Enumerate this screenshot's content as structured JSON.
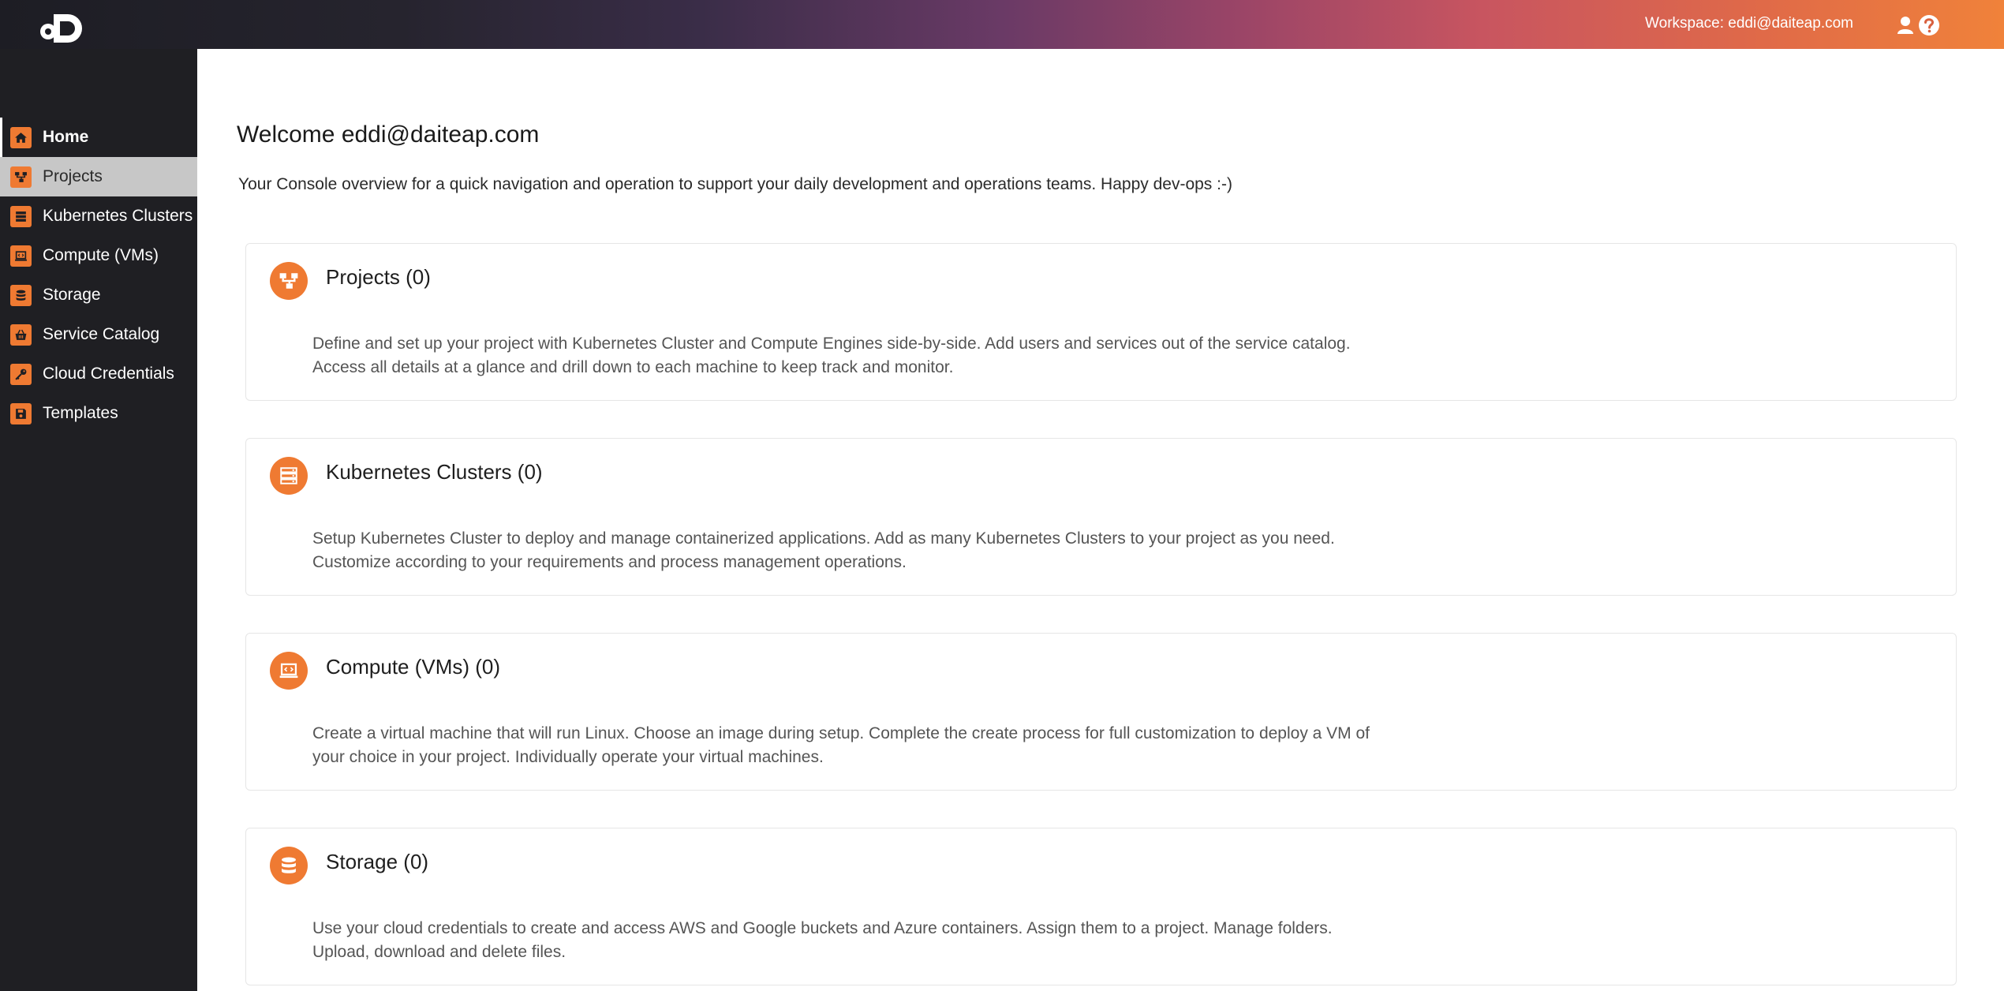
{
  "header": {
    "logo": "daiteap-logo",
    "workspace_label": "Workspace: eddi@daiteap.com",
    "user_icon": "user-icon",
    "help_icon": "help-icon"
  },
  "colors": {
    "accent": "#ef7a32",
    "sidebar_bg": "#1f1f23",
    "hover_bg": "#c7c7c7"
  },
  "sidebar": {
    "items": [
      {
        "label": "Home",
        "icon": "home-icon"
      },
      {
        "label": "Projects",
        "icon": "projects-icon"
      },
      {
        "label": "Kubernetes Clusters",
        "icon": "server-icon"
      },
      {
        "label": "Compute (VMs)",
        "icon": "laptop-icon"
      },
      {
        "label": "Storage",
        "icon": "database-icon"
      },
      {
        "label": "Service Catalog",
        "icon": "basket-icon"
      },
      {
        "label": "Cloud Credentials",
        "icon": "key-icon"
      },
      {
        "label": "Templates",
        "icon": "save-icon"
      }
    ]
  },
  "main": {
    "welcome": "Welcome eddi@daiteap.com",
    "subtitle": "Your Console overview for a quick navigation and operation to support your daily development and operations teams. Happy dev-ops :-)",
    "cards": [
      {
        "title": "Projects (0)",
        "icon": "projects-icon",
        "description": "Define and set up your project with Kubernetes Cluster and Compute Engines side-by-side. Add users and services out of the service catalog. Access all details at a glance and drill down to each machine to keep track and monitor."
      },
      {
        "title": "Kubernetes Clusters (0)",
        "icon": "server-icon",
        "description": "Setup Kubernetes Cluster to deploy and manage containerized applications. Add as many Kubernetes Clusters to your project as you need. Customize according to your requirements and process management operations."
      },
      {
        "title": "Compute (VMs) (0)",
        "icon": "laptop-icon",
        "description": "Create a virtual machine that will run Linux. Choose an image during setup. Complete the create process for full customization to deploy a VM of your choice in your project. Individually operate your virtual machines."
      },
      {
        "title": "Storage (0)",
        "icon": "database-icon",
        "description": "Use your cloud credentials to create and access AWS and Google buckets and Azure containers. Assign them to a project. Manage folders. Upload, download and delete files."
      }
    ]
  }
}
